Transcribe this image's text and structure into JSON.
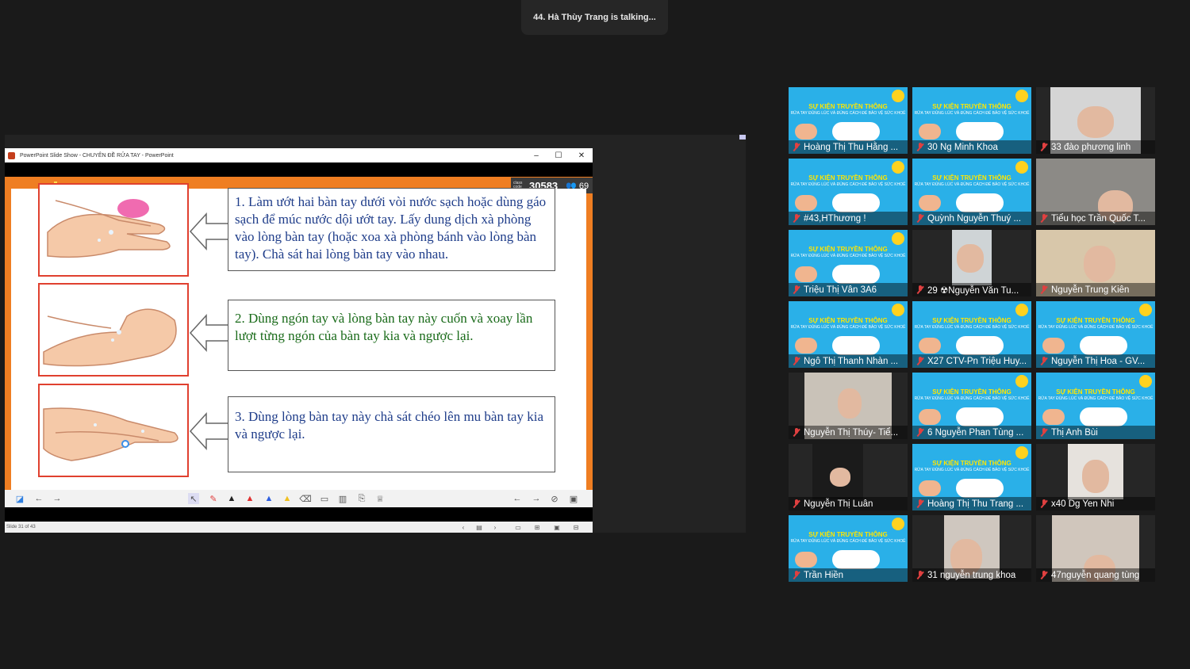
{
  "meeting": {
    "speaking_banner": "44. Hà Thùy Trang is talking..."
  },
  "powerpoint": {
    "window_title": "PowerPoint Slide Show  -  CHUYÊN ĐỀ RỬA TAY - PowerPoint",
    "class_code_label": "class code",
    "class_code": "30583",
    "participant_count": "69",
    "slide_status": "Slide 31 of 43",
    "steps": [
      "1. Làm ướt hai bàn tay dưới vòi nước sạch hoặc dùng gáo sạch để múc nước dội ướt tay. Lấy dung dịch xà phòng vào lòng bàn tay (hoặc xoa xà phòng bánh vào lòng bàn tay). Chà sát hai lòng bàn tay vào nhau.",
      "2. Dùng ngón tay và lòng bàn tay này cuốn và xoay lần lượt từng ngón của bàn tay kia và ngược lại.",
      "3. Dùng lòng bàn tay này chà sát chéo lên mu bàn tay kia và ngược lại."
    ],
    "accent_color": "#ef7e22"
  },
  "poster": {
    "title": "SỰ KIỆN TRUYỀN THÔNG",
    "subtitle": "RỬA TAY ĐÚNG LÚC VÀ ĐÚNG CÁCH ĐỂ BẢO VỆ SỨC KHOẺ"
  },
  "participants": [
    {
      "name": "Hoàng Thị Thu Hằng ...",
      "video": "poster"
    },
    {
      "name": "30 Ng Minh Khoa",
      "video": "poster"
    },
    {
      "name": "33 đào phương linh",
      "video": "camera"
    },
    {
      "name": "#43,HThương !",
      "video": "poster"
    },
    {
      "name": "Quỳnh Nguyễn Thuý ...",
      "video": "poster"
    },
    {
      "name": "Tiểu học Trần Quốc T...",
      "video": "camera"
    },
    {
      "name": "Triệu Thị Vân 3A6",
      "video": "poster"
    },
    {
      "name": "29 ☢Nguyễn Văn Tu...",
      "video": "camera"
    },
    {
      "name": "Nguyễn Trung Kiên",
      "video": "camera"
    },
    {
      "name": "Ngô Thị Thanh Nhàn ...",
      "video": "poster"
    },
    {
      "name": "X27 CTV-Pn Triệu Huy...",
      "video": "poster"
    },
    {
      "name": "Nguyễn Thị Hoa - GV...",
      "video": "poster"
    },
    {
      "name": "Nguyễn Thị Thúy- Tiể...",
      "video": "camera"
    },
    {
      "name": "6 Nguyễn Phan Tùng ...",
      "video": "poster"
    },
    {
      "name": "Thị Anh Bùi",
      "video": "poster"
    },
    {
      "name": "Nguyễn Thị Luân",
      "video": "camera"
    },
    {
      "name": "Hoàng Thị Thu Trang ...",
      "video": "poster"
    },
    {
      "name": "x40    Dg Yen Nhi",
      "video": "camera"
    },
    {
      "name": "Trần Hiền",
      "video": "poster"
    },
    {
      "name": "31 nguyễn trung khoa",
      "video": "camera"
    },
    {
      "name": "47nguyễn quang tùng",
      "video": "camera"
    }
  ]
}
